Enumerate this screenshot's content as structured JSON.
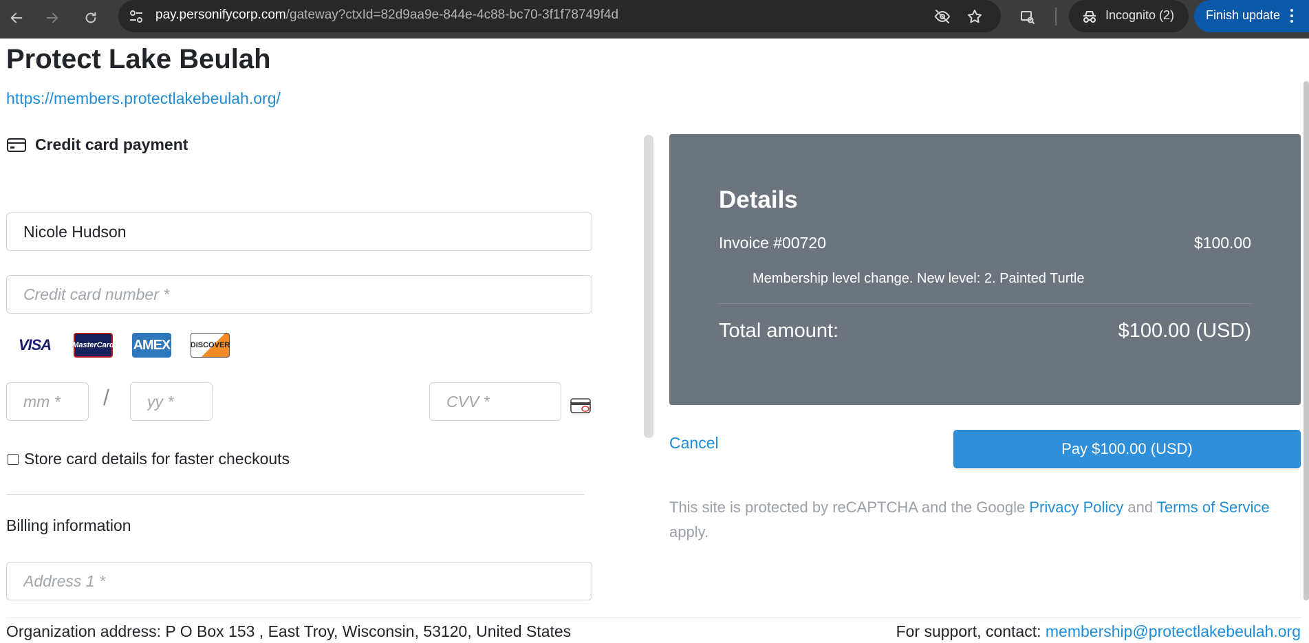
{
  "browser": {
    "url_host": "pay.personifycorp.com",
    "url_path": "/gateway?ctxId=82d9aa9e-844e-4c88-bc70-3f1f78749f4d",
    "incognito_label": "Incognito (2)",
    "finish_update_label": "Finish update",
    "icons": [
      "back-icon",
      "forward-icon",
      "reload-icon",
      "site-info-icon",
      "eye-off-icon",
      "star-icon",
      "lens-icon",
      "incognito-icon",
      "more-icon"
    ]
  },
  "page": {
    "org_name": "Protect Lake Beulah",
    "org_url": "https://members.protectlakebeulah.org/"
  },
  "payment": {
    "section_title": "Credit card payment",
    "cardholder_value": "Nicole Hudson",
    "card_number_placeholder": "Credit card number *",
    "card_brands": [
      "VISA",
      "MasterCard",
      "AMEX",
      "DISCOVER"
    ],
    "month_placeholder": "mm *",
    "year_placeholder": "yy *",
    "date_separator": "/",
    "cvv_placeholder": "CVV *",
    "store_card_label": "Store card details for faster checkouts",
    "store_card_checked": false,
    "billing_title": "Billing information",
    "address1_placeholder": "Address 1 *"
  },
  "details": {
    "title": "Details",
    "invoice_label": "Invoice #00720",
    "invoice_amount": "$100.00",
    "invoice_description": "Membership level change. New level: 2. Painted Turtle",
    "total_label": "Total amount:",
    "total_amount": "$100.00 (USD)",
    "panel_color": "#6c757d"
  },
  "actions": {
    "cancel_label": "Cancel",
    "pay_label": "Pay $100.00 (USD)",
    "pay_color": "#2f8fd8"
  },
  "recaptcha": {
    "prefix": "This site is protected by reCAPTCHA and the Google ",
    "privacy_label": "Privacy Policy",
    "middle": " and ",
    "terms_label": "Terms of Service",
    "suffix": " apply."
  },
  "footer": {
    "org_address": "Organization address: P O Box 153 , East Troy, Wisconsin, 53120, United States",
    "support_prefix": "For support, contact: ",
    "support_email": "membership@protectlakebeulah.org"
  }
}
